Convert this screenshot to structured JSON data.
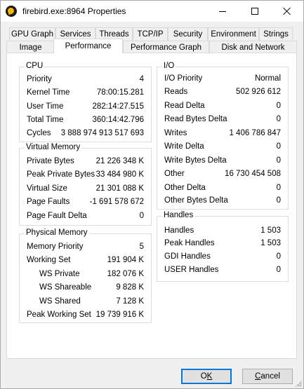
{
  "window": {
    "title": "firebird.exe:8964 Properties",
    "accent": "#0078d7"
  },
  "tabs_row1": [
    "GPU Graph",
    "Services",
    "Threads",
    "TCP/IP",
    "Security",
    "Environment",
    "Strings"
  ],
  "tabs_row2": [
    "Image",
    "Performance",
    "Performance Graph",
    "Disk and Network"
  ],
  "active_tab": "Performance",
  "cpu": {
    "title": "CPU",
    "rows": [
      {
        "label": "Priority",
        "value": "4"
      },
      {
        "label": "Kernel Time",
        "value": "78:00:15.281"
      },
      {
        "label": "User Time",
        "value": "282:14:27.515"
      },
      {
        "label": "Total Time",
        "value": "360:14:42.796"
      },
      {
        "label": "Cycles",
        "value": "3 888 974 913 517 693"
      }
    ]
  },
  "virtual_memory": {
    "title": "Virtual Memory",
    "rows": [
      {
        "label": "Private Bytes",
        "value": "21 226 348 K"
      },
      {
        "label": "Peak Private Bytes",
        "value": "33 484 980 K"
      },
      {
        "label": "Virtual Size",
        "value": "21 301 088 K"
      },
      {
        "label": "Page Faults",
        "value": "-1 691 578 672"
      },
      {
        "label": "Page Fault Delta",
        "value": "0"
      }
    ]
  },
  "physical_memory": {
    "title": "Physical Memory",
    "rows": [
      {
        "label": "Memory Priority",
        "value": "5"
      },
      {
        "label": "Working Set",
        "value": "191 904 K"
      },
      {
        "label": "WS Private",
        "value": "182 076 K"
      },
      {
        "label": "WS Shareable",
        "value": "9 828 K"
      },
      {
        "label": "WS Shared",
        "value": "7 128 K"
      },
      {
        "label": "Peak Working Set",
        "value": "19 739 916 K"
      }
    ]
  },
  "io": {
    "title": "I/O",
    "rows": [
      {
        "label": "I/O Priority",
        "value": "Normal"
      },
      {
        "label": "Reads",
        "value": "502 926 612"
      },
      {
        "label": "Read Delta",
        "value": "0"
      },
      {
        "label": "Read Bytes Delta",
        "value": "0"
      },
      {
        "label": "Writes",
        "value": "1 406 786 847"
      },
      {
        "label": "Write Delta",
        "value": "0"
      },
      {
        "label": "Write Bytes Delta",
        "value": "0"
      },
      {
        "label": "Other",
        "value": "16 730 454 508"
      },
      {
        "label": "Other Delta",
        "value": "0"
      },
      {
        "label": "Other Bytes Delta",
        "value": "0"
      }
    ]
  },
  "handles": {
    "title": "Handles",
    "rows": [
      {
        "label": "Handles",
        "value": "1 503"
      },
      {
        "label": "Peak Handles",
        "value": "1 503"
      },
      {
        "label": "GDI Handles",
        "value": "0"
      },
      {
        "label": "USER Handles",
        "value": "0"
      }
    ]
  },
  "buttons": {
    "ok": {
      "label": "O",
      "underline": "K"
    },
    "cancel": {
      "label_pre": "",
      "underline": "C",
      "label_post": "ancel"
    }
  }
}
